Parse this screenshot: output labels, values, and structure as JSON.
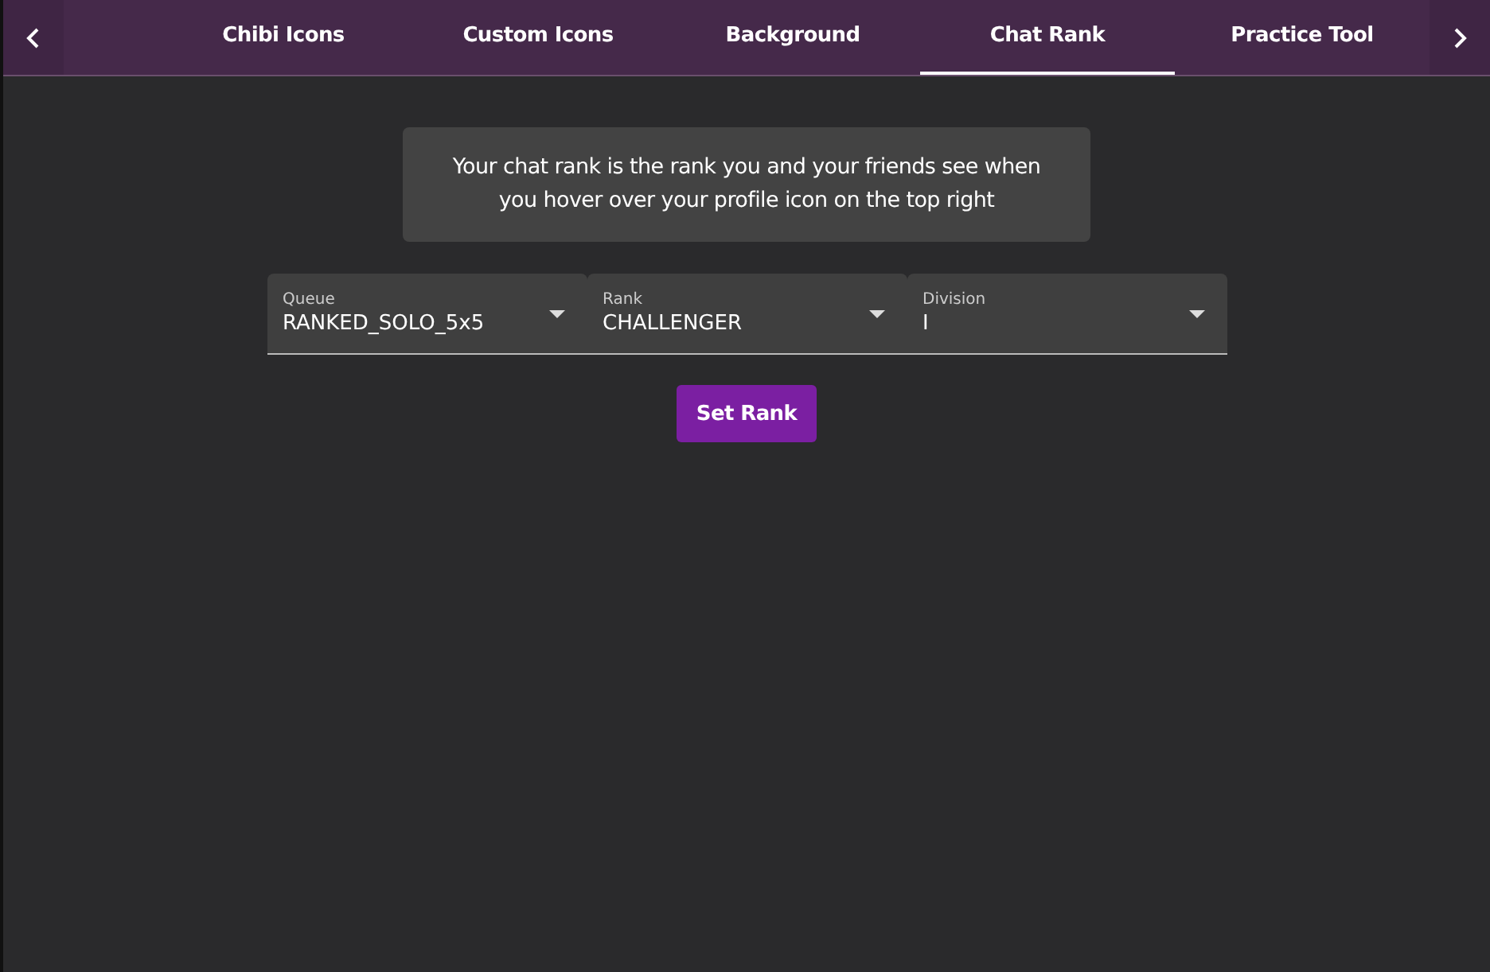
{
  "tabs": [
    {
      "label": "Chibi Icons",
      "selected": false
    },
    {
      "label": "Custom Icons",
      "selected": false
    },
    {
      "label": "Background",
      "selected": false
    },
    {
      "label": "Chat Rank",
      "selected": true
    },
    {
      "label": "Practice Tool",
      "selected": false
    }
  ],
  "info": "Your chat rank is the rank you and your friends see when you hover over your profile icon on the top right",
  "selects": [
    {
      "label": "Queue",
      "value": "RANKED_SOLO_5x5"
    },
    {
      "label": "Rank",
      "value": "CHALLENGER"
    },
    {
      "label": "Division",
      "value": "I"
    }
  ],
  "button": "Set Rank"
}
